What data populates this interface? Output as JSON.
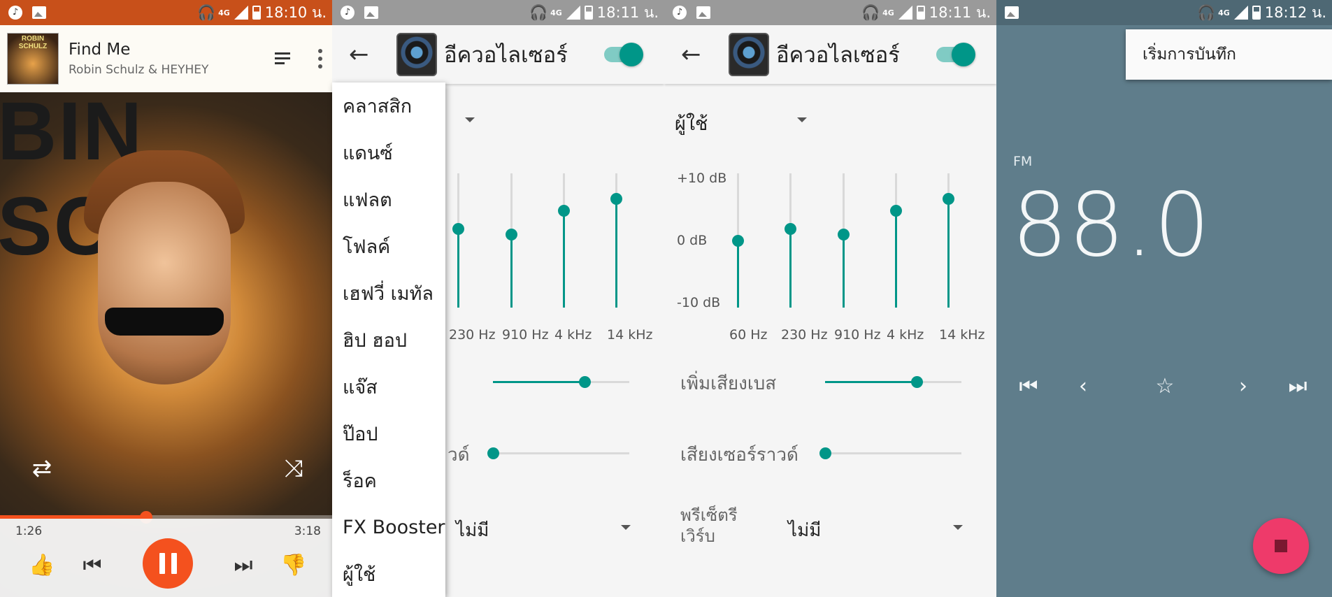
{
  "status_bar": {
    "screen1_time": "18:10 น.",
    "screen2_time": "18:11 น.",
    "screen3_time": "18:11 น.",
    "screen4_time": "18:12 น.",
    "network": "4G"
  },
  "player": {
    "album_label": "ROBIN SCHULZ",
    "art_text": "BIN SCHU",
    "song_title": "Find Me",
    "artist": "Robin Schulz & HEYHEY",
    "elapsed": "1:26",
    "duration": "3:18",
    "progress_fraction": 0.44
  },
  "equalizer": {
    "title": "อีควอไลเซอร์",
    "enabled": true,
    "preset_value": "ผู้ใช้",
    "db_labels": [
      "+10 dB",
      "0 dB",
      "-10 dB"
    ],
    "bands": [
      {
        "freq": "60 Hz",
        "level": 0.5
      },
      {
        "freq": "230 Hz",
        "level": 0.6
      },
      {
        "freq": "910 Hz",
        "level": 0.55
      },
      {
        "freq": "4 kHz",
        "level": 0.75
      },
      {
        "freq": "14 kHz",
        "level": 0.85
      }
    ],
    "bass_label": "เพิ่มเสียงเบส",
    "bass_level": 0.67,
    "surround_label": "เสียงเซอร์ราวด์",
    "surround_partial": "วด์",
    "surround_level": 0.0,
    "reverb_label_line1": "พรีเซ็ตรี",
    "reverb_label_line2": "เวิร์บ",
    "reverb_value": "ไม่มี"
  },
  "preset_menu": {
    "items": [
      "คลาสสิก",
      "แดนซ์",
      "แฟลต",
      "โฟลค์",
      "เฮฟวี่ เมทัล",
      "ฮิป ฮอป",
      "แจ๊ส",
      "ป๊อป",
      "ร็อค",
      "FX Booster",
      "ผู้ใช้"
    ]
  },
  "radio": {
    "menu_item": "เริ่มการบันทึก",
    "band": "FM",
    "frequency": "88.0"
  },
  "colors": {
    "accent_teal": "#009688",
    "player_orange": "#f4511e",
    "radio_bg": "#5f7d8b",
    "fab_pink": "#ee3a6a"
  }
}
